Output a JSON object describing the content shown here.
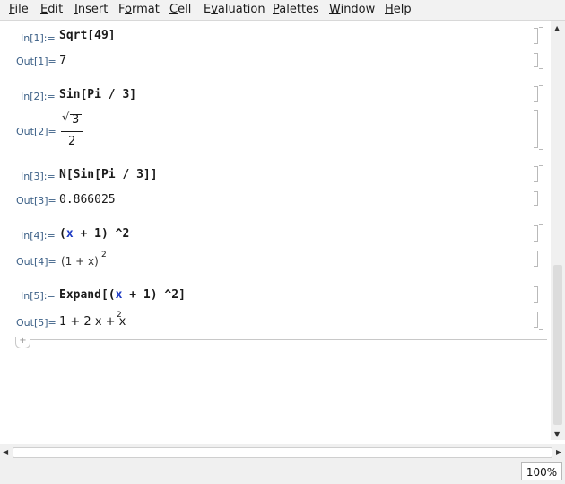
{
  "menu": [
    "File",
    "Edit",
    "Insert",
    "Format",
    "Cell",
    "Evaluation",
    "Palettes",
    "Window",
    "Help"
  ],
  "menu_underline": [
    "F",
    "E",
    "I",
    "o",
    "C",
    "v",
    "P",
    "W",
    "H"
  ],
  "cells": [
    {
      "in_label": "In[1]:=",
      "input": "Sqrt[49]",
      "out_label": "Out[1]=",
      "output": "7"
    },
    {
      "in_label": "In[2]:=",
      "input": "Sin[Pi / 3]",
      "out_label": "Out[2]=",
      "output_radicand": "3",
      "output_denominator": "2"
    },
    {
      "in_label": "In[3]:=",
      "input": "N[Sin[Pi / 3]]",
      "out_label": "Out[3]=",
      "output": "0.866025"
    },
    {
      "in_label": "In[4]:=",
      "input_parts": [
        "(",
        "x",
        " + 1) ^2"
      ],
      "out_label": "Out[4]=",
      "output_parts": [
        "(1 + x)",
        "2"
      ]
    },
    {
      "in_label": "In[5]:=",
      "input_parts": [
        "Expand[(",
        "x",
        " + 1) ^2]"
      ],
      "out_label": "Out[5]=",
      "output_parts": [
        "1 + 2 x + x",
        "2"
      ]
    }
  ],
  "add_cell_symbol": "+",
  "zoom": "100%",
  "icons": {
    "scroll_up": "triangle-up",
    "scroll_down": "triangle-down",
    "scroll_left": "triangle-left",
    "scroll_right": "triangle-right"
  }
}
